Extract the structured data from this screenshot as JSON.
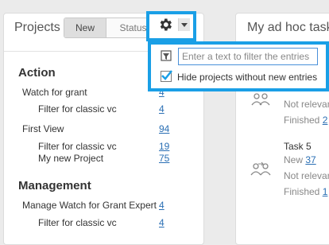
{
  "projects_panel": {
    "title": "Projects",
    "tabs": [
      {
        "label": "New",
        "active": true
      },
      {
        "label": "Status",
        "active": false
      }
    ],
    "settings_icon": "gear-icon",
    "dropdown_icon": "caret-down-icon",
    "sections": [
      {
        "heading": "Action",
        "items": [
          {
            "label": "Watch for grant",
            "count": "4"
          },
          {
            "label": "Filter for classic vc",
            "count": "4"
          },
          {
            "label": "First View",
            "count": "94"
          },
          {
            "label": "Filter for classic vc",
            "count": "19"
          },
          {
            "label": "My new Project",
            "count": "75"
          }
        ]
      },
      {
        "heading": "Management",
        "items": [
          {
            "label": "Manage Watch for Grant Expert",
            "count": "4"
          },
          {
            "label": "Filter for classic vc",
            "count": "4"
          }
        ]
      }
    ]
  },
  "tasks_panel": {
    "title": "My ad hoc tasks",
    "tasks": [
      {
        "title": "",
        "meta": [
          {
            "label": "Not relevant",
            "value": ""
          },
          {
            "label": "Finished",
            "value": "2"
          }
        ]
      },
      {
        "title": "Task 5",
        "meta": [
          {
            "label": "New",
            "value": "37"
          },
          {
            "label": "Not relevant",
            "value": ""
          },
          {
            "label": "Finished",
            "value": "1"
          }
        ]
      }
    ]
  },
  "settings_dropdown": {
    "filter_placeholder": "Enter a text to filter the entries",
    "filter_value": "",
    "hide_projects_label": "Hide projects without new entries",
    "hide_projects_checked": true
  },
  "colors": {
    "highlight": "#1a9fe6",
    "link": "#2a6fb4",
    "check": "#1a9fe6"
  }
}
